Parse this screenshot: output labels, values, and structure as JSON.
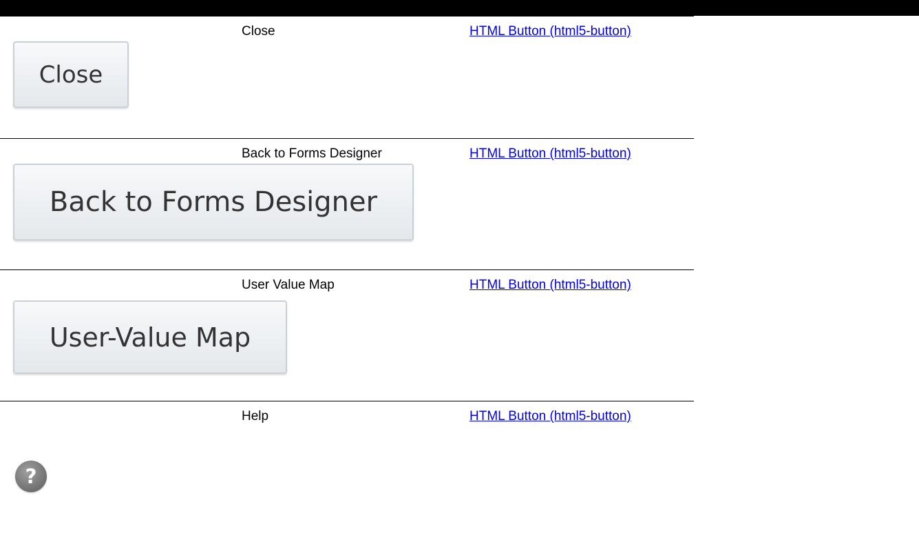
{
  "rows": [
    {
      "name": "Close",
      "link": "HTML Button (html5-button)",
      "preview_label": "Close"
    },
    {
      "name": "Back to Forms Designer",
      "link": "HTML Button (html5-button)",
      "preview_label": "Back to Forms Designer"
    },
    {
      "name": "User Value Map",
      "link": "HTML Button (html5-button)",
      "preview_label": "User-Value Map"
    },
    {
      "name": "Help",
      "link": "HTML Button (html5-button)",
      "preview_icon": "help-question-icon",
      "preview_glyph": "?"
    }
  ],
  "colors": {
    "link": "#0000ee",
    "button_text": "#333333",
    "button_border": "#c9d1d6",
    "help_icon": "#777777"
  }
}
